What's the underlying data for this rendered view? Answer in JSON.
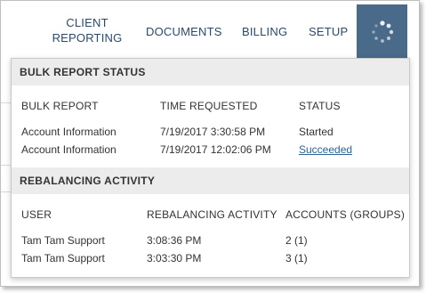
{
  "nav": {
    "client_reporting_line1": "CLIENT",
    "client_reporting_line2": "REPORTING",
    "documents": "DOCUMENTS",
    "billing": "BILLING",
    "setup": "SETUP",
    "status_icon": "spinner-icon",
    "accent_color": "#4a6a8a"
  },
  "bulk_report_status": {
    "title": "BULK REPORT STATUS",
    "columns": [
      "BULK REPORT",
      "TIME REQUESTED",
      "STATUS"
    ],
    "rows": [
      {
        "report": "Account Information",
        "time": "7/19/2017 3:30:58 PM",
        "status": "Started"
      },
      {
        "report": "Account Information",
        "time": "7/19/2017 12:02:06 PM",
        "status": "Succeeded"
      }
    ]
  },
  "rebalancing_activity": {
    "title": "REBALANCING ACTIVITY",
    "columns": [
      "USER",
      "REBALANCING ACTIVITY",
      "ACCOUNTS (GROUPS)"
    ],
    "rows": [
      {
        "user": "Tam Tam Support",
        "activity": "3:08:36 PM",
        "accounts": "2 (1)"
      },
      {
        "user": "Tam Tam Support",
        "activity": "3:03:30 PM",
        "accounts": "3 (1)"
      }
    ]
  }
}
